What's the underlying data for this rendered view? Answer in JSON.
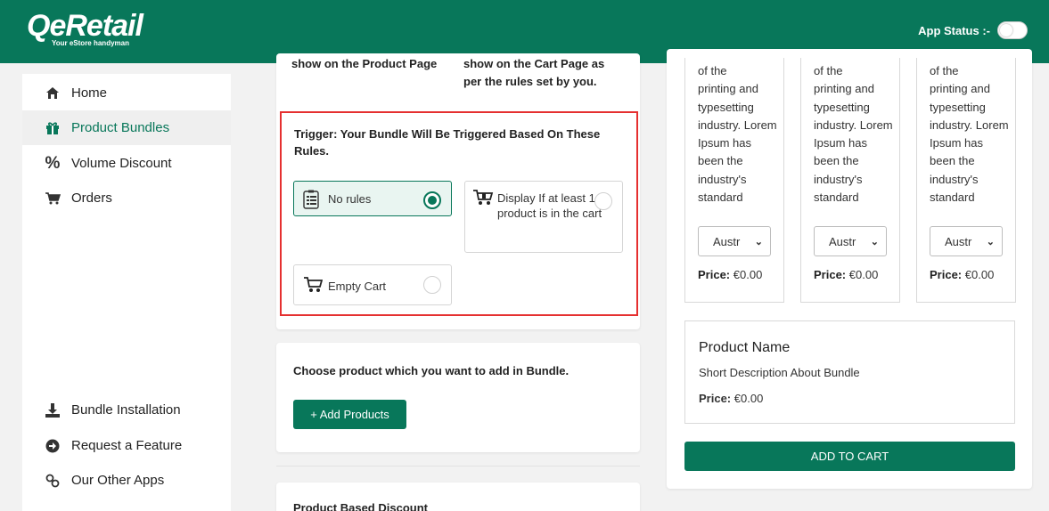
{
  "header": {
    "logo_text": "QeRetail",
    "logo_tagline": "Your eStore handyman",
    "app_status_label": "App Status :-",
    "brand_color": "#08775a"
  },
  "sidebar": {
    "items": [
      {
        "label": "Home",
        "icon": "home-icon"
      },
      {
        "label": "Product Bundles",
        "icon": "gift-icon",
        "active": true
      },
      {
        "label": "Volume Discount",
        "icon": "percent-icon"
      },
      {
        "label": "Orders",
        "icon": "cart-icon"
      },
      {
        "label": "Bundle Installation",
        "icon": "download-icon"
      },
      {
        "label": "Request a Feature",
        "icon": "arrow-circle-icon"
      },
      {
        "label": "Our Other Apps",
        "icon": "link-icon"
      }
    ]
  },
  "display_section": {
    "left_text": "show on the Product Page",
    "right_text_line1": "show on the Cart Page as",
    "right_text_line2": "per the rules set by you."
  },
  "trigger": {
    "title": "Trigger: Your Bundle Will Be Triggered Based On These Rules.",
    "options": [
      {
        "label": "No rules",
        "icon": "checklist-icon",
        "selected": true
      },
      {
        "label": "Display If at least 1 product is in the cart",
        "icon": "cart-icon",
        "selected": false
      },
      {
        "label": "Empty Cart",
        "icon": "cart-icon",
        "selected": false
      }
    ]
  },
  "products_section": {
    "title": "Choose product which you want to add in Bundle.",
    "add_button": "+ Add Products"
  },
  "discount_section": {
    "title": "Product Based Discount"
  },
  "preview": {
    "columns": [
      {
        "desc_top": "of the",
        "desc": "printing and typesetting industry. Lorem Ipsum has been the industry's standard",
        "select": "Austr",
        "price_label": "Price:",
        "price": "€0.00"
      },
      {
        "desc_top": "of the",
        "desc": "printing and typesetting industry. Lorem Ipsum has been the industry's standard",
        "select": "Austr",
        "price_label": "Price:",
        "price": "€0.00"
      },
      {
        "desc_top": "of the",
        "desc": "printing and typesetting industry. Lorem Ipsum has been the industry's standard",
        "select": "Austr",
        "price_label": "Price:",
        "price": "€0.00"
      }
    ],
    "product_name": "Product Name",
    "short_description": "Short Description About Bundle",
    "price_label": "Price:",
    "price": "€0.00",
    "add_to_cart": "ADD TO CART"
  }
}
